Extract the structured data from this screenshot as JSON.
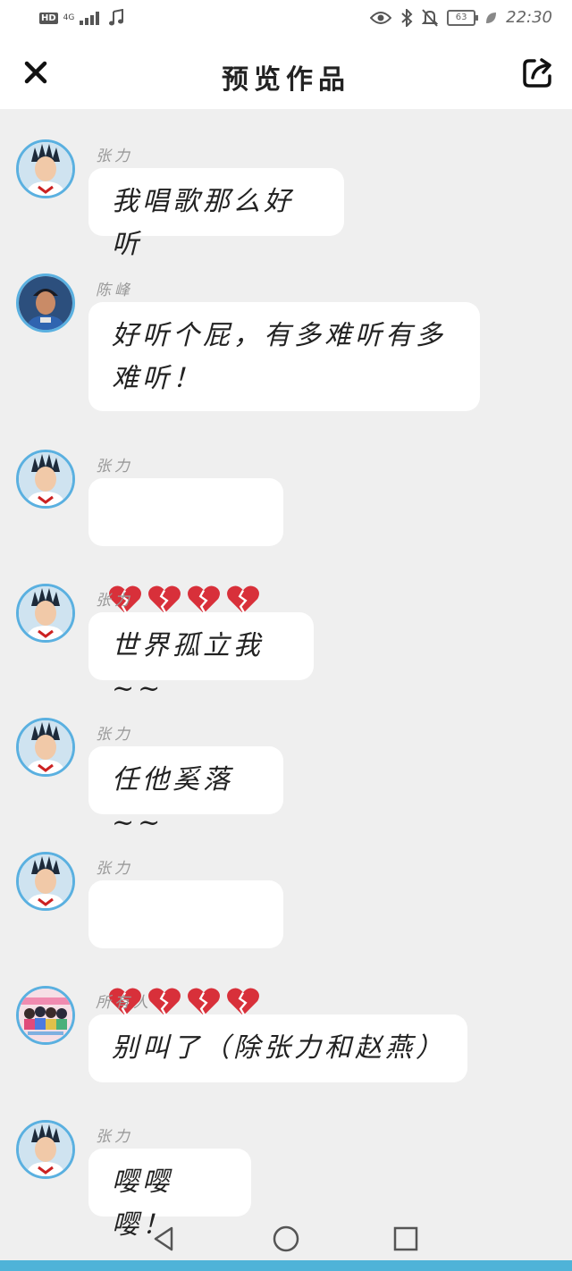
{
  "status_bar": {
    "hd": "HD",
    "network": "4G",
    "music_icon": "music-note-icon",
    "battery": "63",
    "time": "22:30"
  },
  "header": {
    "title": "预览作品",
    "close_icon": "close-icon",
    "share_icon": "share-icon"
  },
  "messages": [
    {
      "sender": "张力",
      "avatar": "zhangli",
      "text": "我唱歌那么好听"
    },
    {
      "sender": "陈峰",
      "avatar": "chenfeng",
      "text": "好听个屁，有多难听有多难听！"
    },
    {
      "sender": "张力",
      "avatar": "zhangli",
      "emoji": "broken-heart",
      "emoji_count": 4
    },
    {
      "sender": "张力",
      "avatar": "zhangli",
      "text": "世界孤立我~~"
    },
    {
      "sender": "张力",
      "avatar": "zhangli",
      "text": "任他奚落~~"
    },
    {
      "sender": "张力",
      "avatar": "zhangli",
      "emoji": "broken-heart",
      "emoji_count": 4
    },
    {
      "sender": "所有人",
      "avatar": "group",
      "text": "别叫了（除张力和赵燕）"
    },
    {
      "sender": "张力",
      "avatar": "zhangli",
      "text": "嘤嘤嘤！"
    }
  ],
  "navbar": {
    "back_icon": "back-triangle-icon",
    "home_icon": "home-circle-icon",
    "recent_icon": "recent-square-icon"
  },
  "colors": {
    "background": "#efefef",
    "bubble": "#ffffff",
    "avatar_ring": "#5ab0e0",
    "heart": "#d8303a"
  }
}
